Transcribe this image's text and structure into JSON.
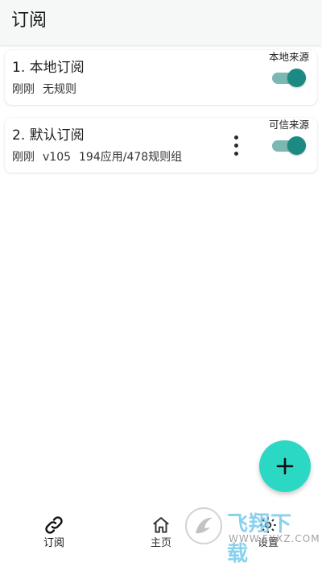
{
  "header": {
    "title": "订阅"
  },
  "subscriptions": [
    {
      "name": "1. 本地订阅",
      "time": "刚刚",
      "rules": "无规则",
      "source_label": "本地来源",
      "enabled": true
    },
    {
      "name": "2. 默认订阅",
      "time": "刚刚",
      "version": "v105",
      "rules": "194应用/478规则组",
      "source_label": "可信来源",
      "enabled": true
    }
  ],
  "fab": {
    "icon": "plus-icon"
  },
  "nav": {
    "items": [
      {
        "label": "订阅",
        "icon": "link-icon",
        "active": true
      },
      {
        "label": "主页",
        "icon": "home-icon",
        "active": false
      },
      {
        "label": "设置",
        "icon": "settings-icon",
        "active": false
      }
    ]
  },
  "watermark": {
    "text": "飞翔下载",
    "url": "WWW.FXXZ.COM"
  },
  "colors": {
    "accent": "#2bd8c4",
    "switch_thumb": "#1a8a82",
    "switch_track": "#7cb8b3",
    "header_bg": "#f6f8f7"
  }
}
